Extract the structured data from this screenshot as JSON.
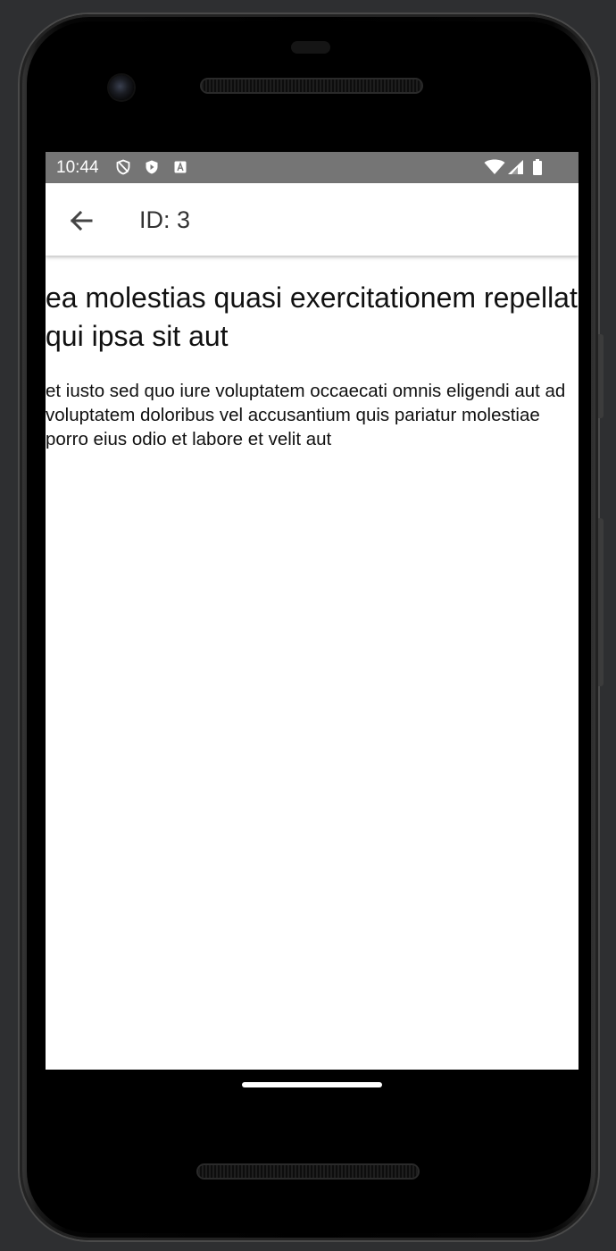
{
  "status_bar": {
    "time": "10:44",
    "left_icons": [
      "shield-outline-icon",
      "shield-play-icon",
      "keyboard-a-icon"
    ],
    "right_icons": [
      "wifi-icon",
      "cell-signal-icon",
      "battery-icon"
    ],
    "background": "#757575"
  },
  "app_bar": {
    "back_icon": "arrow-back-icon",
    "title": "ID: 3"
  },
  "post": {
    "title": "ea molestias quasi exercitationem repellat qui ipsa sit aut",
    "body": "et iusto sed quo iure voluptatem occaecati omnis eligendi aut ad voluptatem doloribus vel accusantium quis pariatur molestiae porro eius odio et labore et velit aut"
  }
}
